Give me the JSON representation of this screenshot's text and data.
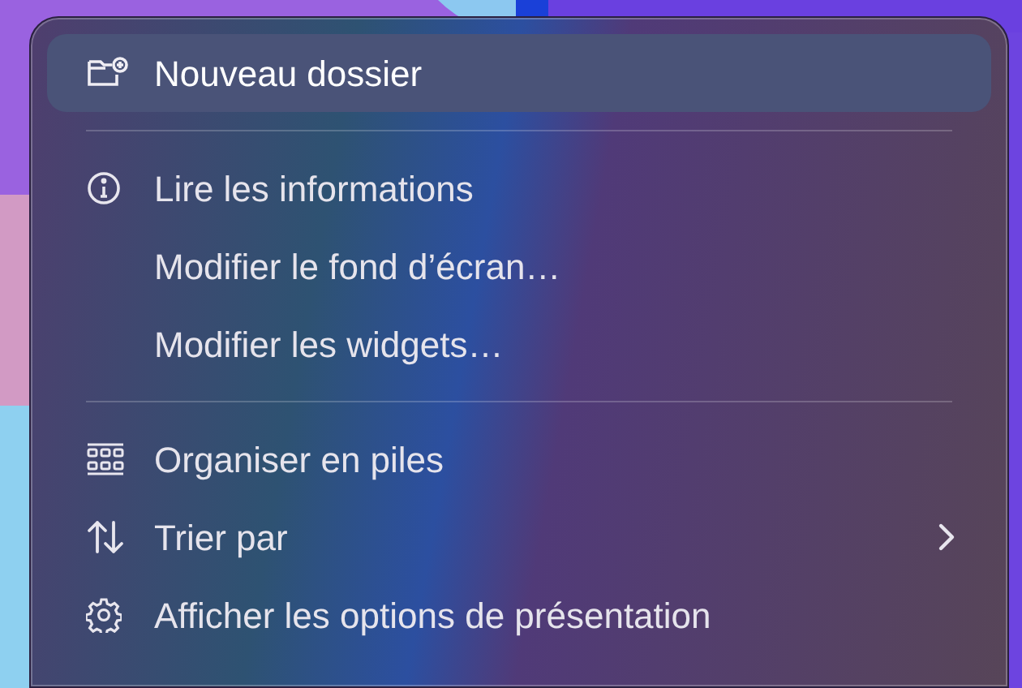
{
  "menu": {
    "groups": [
      [
        {
          "label": "Nouveau dossier",
          "selected": true,
          "submenu": false
        }
      ],
      [
        {
          "label": "Lire les informations",
          "selected": false,
          "submenu": false
        },
        {
          "label": "Modifier le fond d’écran…",
          "selected": false,
          "submenu": false
        },
        {
          "label": "Modifier les widgets…",
          "selected": false,
          "submenu": false
        }
      ],
      [
        {
          "label": "Organiser en piles",
          "selected": false,
          "submenu": false
        },
        {
          "label": "Trier par",
          "selected": false,
          "submenu": true
        },
        {
          "label": "Afficher les options de présentation",
          "selected": false,
          "submenu": false
        }
      ]
    ]
  }
}
